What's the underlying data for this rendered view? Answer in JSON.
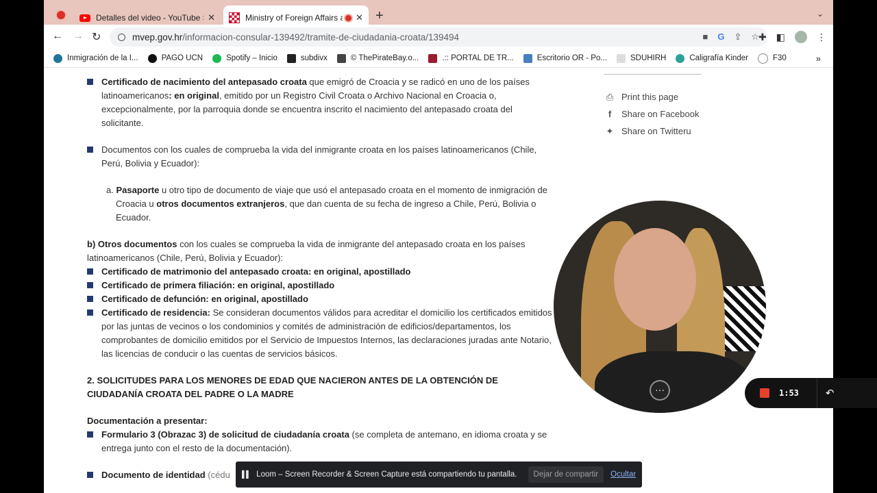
{
  "browser": {
    "tabs": [
      {
        "title": "Detalles del video - YouTube St",
        "icon": "youtube-icon"
      },
      {
        "title": "Ministry of Foreign Affairs a",
        "icon": "croatia-icon",
        "active": true
      }
    ],
    "url_host": "mvep.gov.hr",
    "url_path": "/informacion-consular-139492/tramite-de-ciudadania-croata/139494",
    "bookmarks": [
      "Inmigración de la I...",
      "PAGO UCN",
      "Spotify – Inicio",
      "subdivx",
      "© ThePirateBay.o...",
      ".:: PORTAL DE TR...",
      "Escritorio OR - Po...",
      "SDUHIRH",
      "Caligrafía Kinder",
      "F30"
    ]
  },
  "content": {
    "item1_bold": "Certificado de nacimiento del antepasado croata",
    "item1_text1": " que emigró de Croacia y se radicó en uno de los países latinoamericanos",
    "item1_bold2": ": en original",
    "item1_text2": ", emitido por un Registro Civil Croata o Archivo Nacional en Croacia o, excepcionalmente, por la parroquia donde se encuentra inscrito el nacimiento del antepasado croata del solicitante.",
    "item2_text": "Documentos con los cuales de comprueba la vida del inmigrante croata en los países latinoamericanos (Chile, Perú, Bolivia y Ecuador):",
    "suba_prefix": "a. ",
    "suba_bold1": "Pasaporte",
    "suba_text1": " u otro tipo de documento de viaje que usó el antepasado croata en el momento de inmigración de Croacia u ",
    "suba_bold2": "otros documentos extranjeros",
    "suba_text2": ", que dan cuenta de su fecha de ingreso a Chile, Perú, Bolivia o Ecuador.",
    "b_bold": "b) Otros documentos",
    "b_text": " con los cuales se comprueba la vida de inmigrante del antepasado croata en los países latinoamericanos (Chile, Perú, Bolivia y Ecuador):",
    "b_items": [
      "Certificado de matrimonio del antepasado croata: en original, apostillado",
      "Certificado de primera filiación: en original, apostillado",
      "Certificado de defunción: en original, apostillado"
    ],
    "res_bold": "Certificado de residencia:",
    "res_text": " Se consideran documentos válidos para acreditar el domicilio los certificados emitidos por las juntas de vecinos o los condominios y comités de administración de edificios/departamentos, los comprobantes de domicilio emitidos por el Servicio de Impuestos Internos, las declaraciones juradas ante Notario, las licencias de conducir o las cuentas de servicios básicos.",
    "section2_heading": "2. SOLICITUDES PARA LOS MENORES DE EDAD QUE NACIERON ANTES DE LA OBTENCIÓN DE CIUDADANÍA CROATA DEL PADRE O LA MADRE",
    "doc_heading": "Documentación a presentar:",
    "form3_bold": "Formulario 3 (Obrazac 3) de solicitud de ciudadanía croata",
    "form3_text": " (se completa de antemano, en idioma croata y se entrega junto con el resto de la documentación).",
    "id_bold": "Documento de identidad",
    "id_text": " (cédu"
  },
  "sidebar": {
    "print": "Print this page",
    "facebook": "Share on Facebook",
    "twitter": "Share on Twitteru"
  },
  "loom": {
    "timer": "1:53",
    "share_message": "Loom – Screen Recorder & Screen Capture está compartiendo tu pantalla.",
    "stop_label": "Dejar de compartir",
    "hide_label": "Ocultar"
  }
}
